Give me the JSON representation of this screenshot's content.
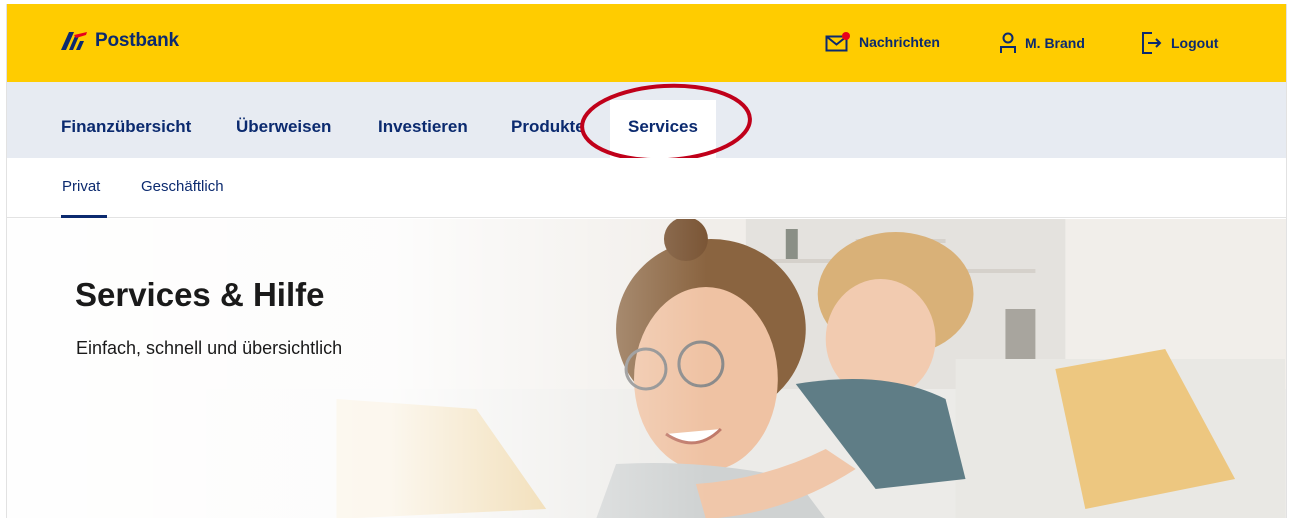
{
  "header": {
    "brand": "Postbank",
    "messages_label": "Nachrichten",
    "user_label": "M. Brand",
    "logout_label": "Logout",
    "brand_color": "#0b2a6f",
    "bar_color": "#ffcc00"
  },
  "mainnav": {
    "items": [
      {
        "label": "Finanzübersicht"
      },
      {
        "label": "Überweisen"
      },
      {
        "label": "Investieren"
      },
      {
        "label": "Produkte"
      },
      {
        "label": "Services",
        "active": true
      }
    ]
  },
  "subnav": {
    "items": [
      {
        "label": "Privat",
        "active": true
      },
      {
        "label": "Geschäftlich"
      }
    ]
  },
  "hero": {
    "title": "Services & Hilfe",
    "subtitle": "Einfach, schnell und übersichtlich"
  },
  "annotation": {
    "color": "#c0001a"
  }
}
